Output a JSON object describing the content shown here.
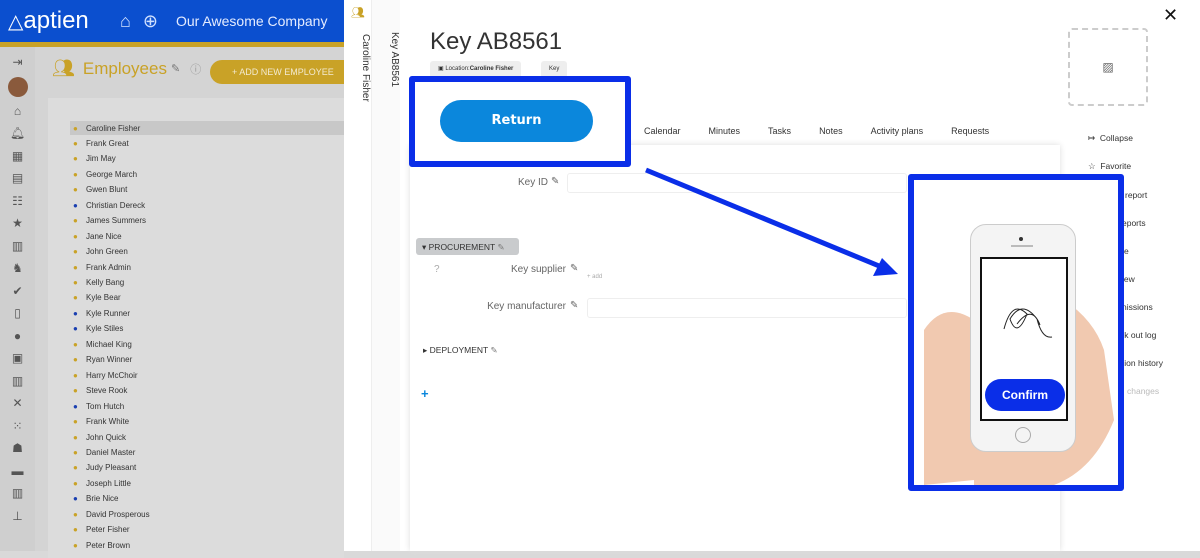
{
  "app": {
    "logo": "aptien",
    "company": "Our Awesome Company"
  },
  "employees": {
    "title": "Employees",
    "add_button": "+ ADD NEW EMPLOYEE",
    "list": [
      {
        "name": "Caroline Fisher",
        "color": "#c9a227"
      },
      {
        "name": "Frank Great",
        "color": "#c9a227"
      },
      {
        "name": "Jim May",
        "color": "#c9a227"
      },
      {
        "name": "George March",
        "color": "#c9a227"
      },
      {
        "name": "Gwen Blunt",
        "color": "#c9a227"
      },
      {
        "name": "Christian Dereck",
        "color": "#1a3fb0"
      },
      {
        "name": "James Summers",
        "color": "#c9a227"
      },
      {
        "name": "Jane Nice",
        "color": "#c9a227"
      },
      {
        "name": "John Green",
        "color": "#c9a227"
      },
      {
        "name": "Frank Admin",
        "color": "#c9a227"
      },
      {
        "name": "Kelly Bang",
        "color": "#c9a227"
      },
      {
        "name": "Kyle Bear",
        "color": "#c9a227"
      },
      {
        "name": "Kyle Runner",
        "color": "#1a3fb0"
      },
      {
        "name": "Kyle Stiles",
        "color": "#1a3fb0"
      },
      {
        "name": "Michael King",
        "color": "#c9a227"
      },
      {
        "name": "Ryan Winner",
        "color": "#c9a227"
      },
      {
        "name": "Harry McChoir",
        "color": "#c9a227"
      },
      {
        "name": "Steve Rook",
        "color": "#c9a227"
      },
      {
        "name": "Tom Hutch",
        "color": "#1a3fb0"
      },
      {
        "name": "Frank White",
        "color": "#c9a227"
      },
      {
        "name": "John Quick",
        "color": "#c9a227"
      },
      {
        "name": "Daniel Master",
        "color": "#c9a227"
      },
      {
        "name": "Judy Pleasant",
        "color": "#c9a227"
      },
      {
        "name": "Joseph Little",
        "color": "#c9a227"
      },
      {
        "name": "Brie Nice",
        "color": "#1a3fb0"
      },
      {
        "name": "David Prosperous",
        "color": "#c9a227"
      },
      {
        "name": "Peter Fisher",
        "color": "#c9a227"
      },
      {
        "name": "Peter Brown",
        "color": "#c9a227"
      }
    ]
  },
  "vtabs": [
    "Caroline Fisher",
    "Key AB8561"
  ],
  "detail": {
    "title": "Key AB8561",
    "location_label": "Location:",
    "location_value": "Caroline Fisher",
    "type_chip": "Key",
    "tabs": [
      "Calendar",
      "Minutes",
      "Tasks",
      "Notes",
      "Activity plans",
      "Requests"
    ],
    "key_id_label": "Key ID",
    "procurement": "PROCUREMENT",
    "key_supplier_label": "Key supplier",
    "add_link": "+ add",
    "key_manufacturer_label": "Key manufacturer",
    "deployment": "DEPLOYMENT",
    "add_plus": "+"
  },
  "right_menu": [
    "Collapse",
    "Favorite",
    "report",
    "eports",
    "e",
    "iew",
    "nissions",
    "ck out log",
    "sion history",
    "changes"
  ],
  "overlay": {
    "return_button": "Return",
    "confirm_button": "Confirm"
  },
  "colors": {
    "brand_blue": "#0b4fcf",
    "gold": "#c9a227",
    "highlight": "#0a2ee8",
    "return": "#0b87dc"
  }
}
